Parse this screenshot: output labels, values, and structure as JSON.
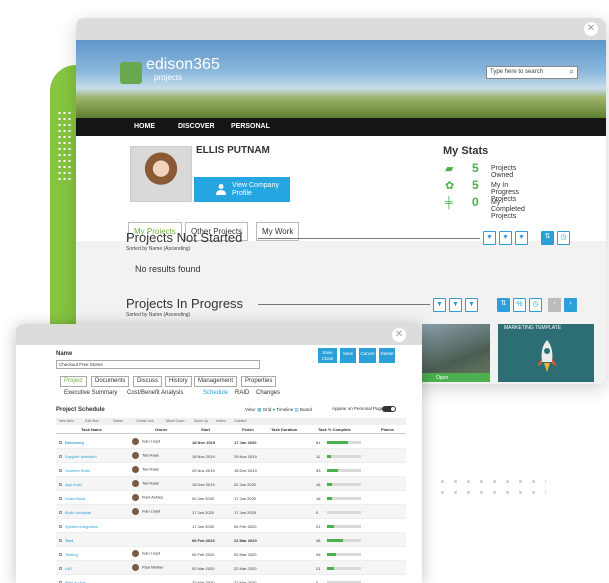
{
  "brand": {
    "name": "edison365",
    "sub": "projects"
  },
  "search": {
    "placeholder": "Type here to search"
  },
  "nav": [
    "HOME",
    "DISCOVER",
    "PERSONAL"
  ],
  "profile": {
    "name": "ELLIS PUTNAM",
    "company_button": "View Company Profile"
  },
  "stats": {
    "title": "My Stats",
    "items": [
      {
        "value": "5",
        "label": "Projects Owned",
        "icon": "folder-icon"
      },
      {
        "value": "5",
        "label": "My In Progress Projects",
        "icon": "gear-icon"
      },
      {
        "value": "0",
        "label": "My Completed Projects",
        "icon": "signpost-icon"
      }
    ]
  },
  "main_tabs": [
    "My Projects",
    "Other Projects",
    "My Work"
  ],
  "sections": {
    "not_started": {
      "title": "Projects Not Started",
      "sort": "Sorted by Name (Ascending)",
      "empty": "No results found"
    },
    "in_progress": {
      "title": "Projects In Progress",
      "sort": "Sorted by Name (Ascending)"
    }
  },
  "tiles": {
    "open_label": "Open",
    "marketing_label": "MARKETING TEMPLATE"
  },
  "colors": {
    "accent_green": "#6cb33f",
    "accent_blue": "#2b9fd8",
    "nav_bg": "#151515",
    "stat_green": "#4caf50"
  },
  "project_form": {
    "name_label": "Name",
    "name_value": "Checkout Free Stores",
    "buttons": [
      "Save Close",
      "Save",
      "Cancel",
      "Delete"
    ],
    "tabs": [
      "Project",
      "Documents",
      "Discuss",
      "History",
      "Management",
      "Properties"
    ],
    "subtabs": [
      "Executive Summary",
      "Cost/Benefit Analysis",
      "Schedule",
      "RAID",
      "Changes"
    ],
    "schedule_title": "Project Schedule",
    "view_label": "View:",
    "view_options": [
      "Grid",
      "Timeline",
      "Board"
    ],
    "appear_label": "Appear on Personal Page",
    "toolbar": [
      "New Item",
      "Edit Item",
      "Delete",
      "Create Link",
      "Move Down",
      "Move Up",
      "Indent",
      "Outdent"
    ],
    "columns": [
      "Task Name",
      "Owner",
      "Start",
      "Finish",
      "Task Duration",
      "Task % Complete",
      "Planne"
    ],
    "rows": [
      {
        "name": "Discovery",
        "owner": "Ivan Lloyd",
        "start": "18 Nov 2019",
        "finish": "17 Jan 2020",
        "pct": "61",
        "progress": 0.61,
        "bold": true
      },
      {
        "name": "Supplier selection",
        "owner": "Tad Haas",
        "start": "18 Nov 2019",
        "finish": "29 Nov 2019",
        "pct": "11",
        "progress": 0.11,
        "bold": false
      },
      {
        "name": "Scanner Build",
        "owner": "Tad Haas",
        "start": "29 Nov 2019",
        "finish": "18 Dec 2019",
        "pct": "33",
        "progress": 0.33,
        "bold": false
      },
      {
        "name": "App build",
        "owner": "Tad Haas",
        "start": "18 Dec 2019",
        "finish": "02 Jan 2020",
        "pct": "16",
        "progress": 0.16,
        "bold": false
      },
      {
        "name": "Video Build",
        "owner": "Roni Ashley",
        "start": "02 Jan 2020",
        "finish": "17 Jan 2020",
        "pct": "16",
        "progress": 0.16,
        "bold": false
      },
      {
        "name": "Build complete",
        "owner": "Ivan Lloyd",
        "start": "17 Jan 2020",
        "finish": "17 Jan 2020",
        "pct": "0",
        "progress": 0,
        "bold": false
      },
      {
        "name": "System integration",
        "owner": "",
        "start": "17 Jan 2020",
        "finish": "06 Feb 2020",
        "pct": "21",
        "progress": 0.21,
        "bold": false
      },
      {
        "name": "Test",
        "owner": "",
        "start": "06 Feb 2020",
        "finish": "22 Mar 2020",
        "pct": "46",
        "progress": 0.46,
        "bold": true
      },
      {
        "name": "Testing",
        "owner": "Ivan Lloyd",
        "start": "06 Feb 2020",
        "finish": "02 Mar 2020",
        "pct": "26",
        "progress": 0.26,
        "bold": false
      },
      {
        "name": "UAT",
        "owner": "Paul Mather",
        "start": "02 Mar 2020",
        "finish": "22 Mar 2020",
        "pct": "21",
        "progress": 0.21,
        "bold": false
      },
      {
        "name": "Plan go live",
        "owner": "",
        "start": "22 Mar 2020",
        "finish": "22 Mar 2020",
        "pct": "0",
        "progress": 0,
        "bold": false
      }
    ]
  }
}
